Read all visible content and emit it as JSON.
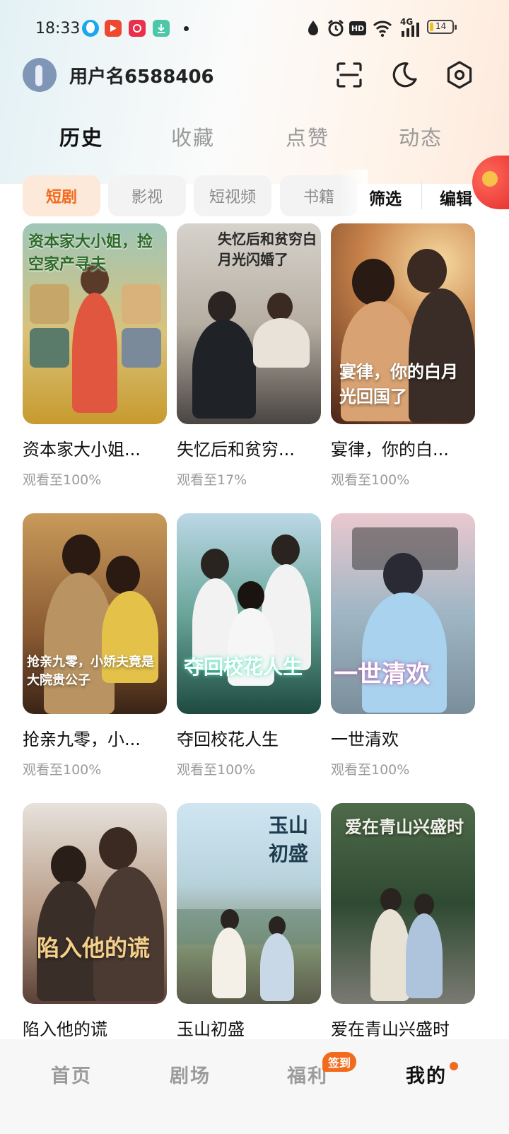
{
  "status_bar": {
    "time": "18:33",
    "hd": "HD",
    "network": "4G",
    "battery": "14",
    "icons": [
      "qq-icon",
      "video-app-icon",
      "red-app-icon",
      "download-icon",
      "location-icon",
      "alarm-icon",
      "hd-icon",
      "wifi-icon",
      "signal-icon",
      "battery-icon"
    ]
  },
  "header": {
    "username": "用户名6588406",
    "icons": [
      "scan-icon",
      "moon-icon",
      "settings-icon"
    ]
  },
  "tabs": [
    {
      "label": "历史",
      "active": true
    },
    {
      "label": "收藏",
      "active": false
    },
    {
      "label": "点赞",
      "active": false
    },
    {
      "label": "动态",
      "active": false
    }
  ],
  "filters": [
    {
      "label": "短剧",
      "active": true
    },
    {
      "label": "影视",
      "active": false
    },
    {
      "label": "短视频",
      "active": false
    },
    {
      "label": "书籍",
      "active": false
    }
  ],
  "actions": {
    "filter": "筛选",
    "edit": "编辑"
  },
  "items": [
    {
      "title": "资本家大小姐...",
      "progress": "观看至100%",
      "poster_text": "资本家大小姐，捡空家产寻夫",
      "accent": "#c9a93a"
    },
    {
      "title": "失忆后和贫穷...",
      "progress": "观看至17%",
      "poster_text": "失忆后和贫穷白月光闪婚了",
      "accent": "#8a7a6e"
    },
    {
      "title": "宴律，你的白...",
      "progress": "观看至100%",
      "poster_text": "宴律，你的白月光回国了",
      "accent": "#a0603a"
    },
    {
      "title": "抢亲九零，小...",
      "progress": "观看至100%",
      "poster_text": "抢亲九零，小娇夫竟是大院贵公子",
      "accent": "#b07a3a"
    },
    {
      "title": "夺回校花人生",
      "progress": "观看至100%",
      "poster_text": "夺回校花人生",
      "accent": "#2f6a5e"
    },
    {
      "title": "一世清欢",
      "progress": "观看至100%",
      "poster_text": "一世清欢",
      "accent": "#6f9ec0"
    },
    {
      "title": "陷入他的谎",
      "progress": "",
      "poster_text": "陷入他的谎",
      "accent": "#6a4a3a"
    },
    {
      "title": "玉山初盛",
      "progress": "",
      "poster_text": "玉山初盛",
      "accent": "#6fa7c7"
    },
    {
      "title": "爱在青山兴盛时",
      "progress": "",
      "poster_text": "爱在青山兴盛时",
      "accent": "#3e5a3a"
    }
  ],
  "bottom_nav": [
    {
      "label": "首页",
      "active": false
    },
    {
      "label": "剧场",
      "active": false
    },
    {
      "label": "福利",
      "active": false,
      "badge": "签到"
    },
    {
      "label": "我的",
      "active": true
    }
  ]
}
